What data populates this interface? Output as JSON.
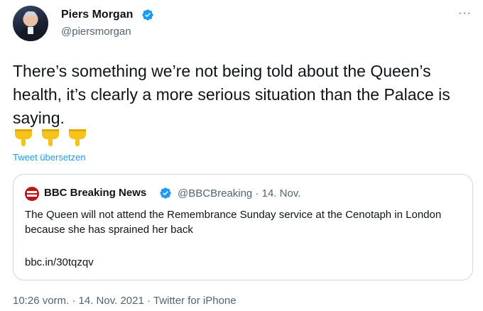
{
  "author": {
    "name": "Piers Morgan",
    "handle": "@piersmorgan"
  },
  "more_label": "···",
  "tweet": {
    "text": "There’s something we’re not being told about the Queen’s health, it’s clearly a more serious situation than the Palace is saying.",
    "emojis": [
      "pointing-down-hand",
      "pointing-down-hand",
      "pointing-down-hand"
    ],
    "translate_label": "Tweet übersetzen"
  },
  "quoted_tweet": {
    "name": "BBC Breaking News",
    "meta": "@BBCBreaking · 14. Nov.",
    "text": "The Queen will not attend the Remembrance Sunday service at the Cenotaph in London because she has sprained her back",
    "link": "bbc.in/30tqzqv"
  },
  "footer": {
    "meta": "10:26 vorm. · 14. Nov. 2021 · Twitter for iPhone"
  },
  "colors": {
    "accent": "#1d9bf0",
    "secondary_text": "#536471",
    "border": "#cfd9de",
    "bbc_red": "#bb1919",
    "emoji_yellow": "#f6c21c"
  }
}
